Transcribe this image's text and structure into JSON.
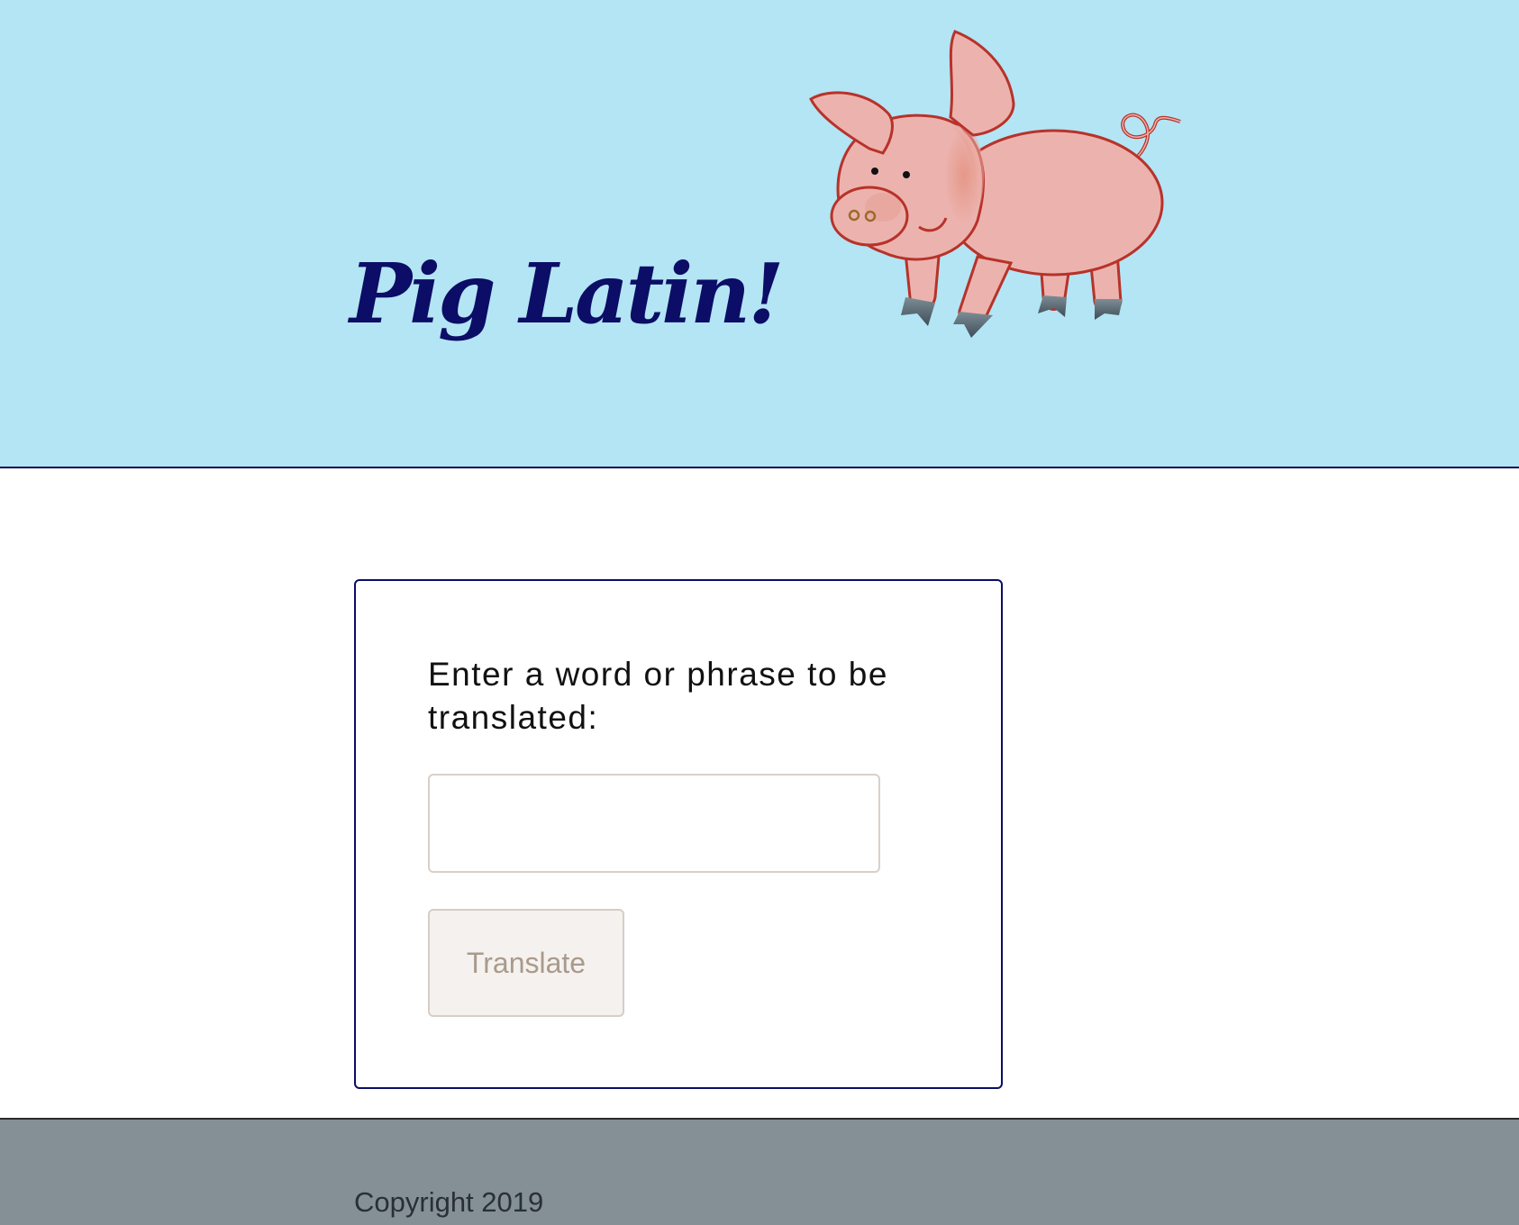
{
  "header": {
    "title": "Pig Latin!",
    "background_color": "#b3e5f4",
    "title_color": "#0b0d66",
    "logo_icon": "pig-icon"
  },
  "form": {
    "prompt": "Enter a word or phrase to be translated:",
    "input_value": "",
    "input_placeholder": "",
    "button_label": "Translate",
    "border_color": "#0b0d66"
  },
  "footer": {
    "copyright": "Copyright 2019",
    "background_color": "#848f96"
  }
}
